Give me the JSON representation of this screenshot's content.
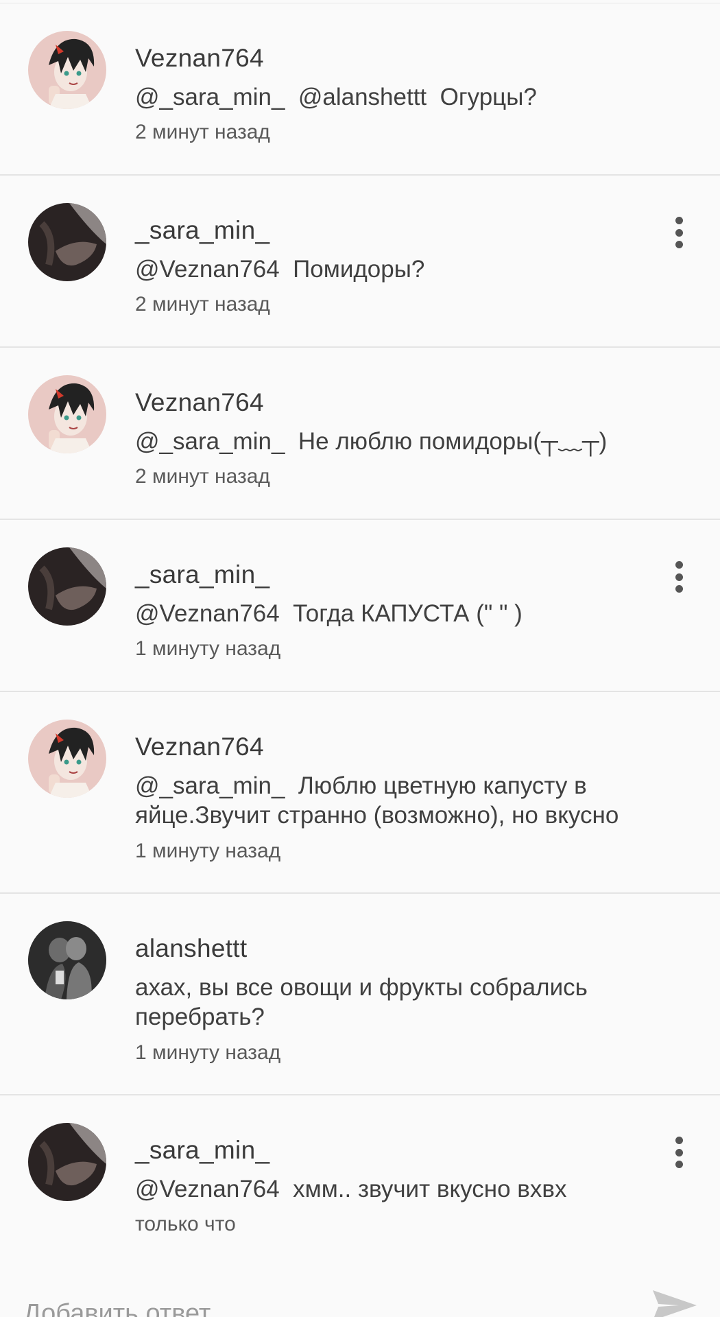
{
  "comments": [
    {
      "username": "Veznan764",
      "text": "@_sara_min_  @alanshettt  Огурцы?",
      "time": "2 минут назад",
      "avatar": "anime-boy-avatar",
      "has_menu": false
    },
    {
      "username": "_sara_min_",
      "text": "@Veznan764  Помидоры?",
      "time": "2 минут назад",
      "avatar": "dark-photo-avatar",
      "has_menu": true
    },
    {
      "username": "Veznan764",
      "text": "@_sara_min_  Не люблю помидоры(┬﹏┬)",
      "time": "2 минут назад",
      "avatar": "anime-boy-avatar",
      "has_menu": false
    },
    {
      "username": "_sara_min_",
      "text": "@Veznan764  Тогда КАПУСТА (\" \" )",
      "time": "1 минуту назад",
      "avatar": "dark-photo-avatar",
      "has_menu": true
    },
    {
      "username": "Veznan764",
      "text": "@_sara_min_  Люблю цветную капусту в яйце.Звучит странно (возможно), но вкусно",
      "time": "1 минуту назад",
      "avatar": "anime-boy-avatar",
      "has_menu": false
    },
    {
      "username": "alanshettt",
      "text": "ахах, вы все овощи и фрукты собрались перебрать?",
      "time": "1 минуту назад",
      "avatar": "couple-photo-avatar",
      "has_menu": false
    },
    {
      "username": "_sara_min_",
      "text": "@Veznan764  хмм.. звучит вкусно вхвх",
      "time": "только что",
      "avatar": "dark-photo-avatar",
      "has_menu": true
    }
  ],
  "reply": {
    "placeholder": "Добавить ответ",
    "send_icon": "send-arrow-icon"
  },
  "colors": {
    "background": "#fafafa",
    "divider": "#e4e4e4",
    "text": "#404040",
    "placeholder": "#9a9a9a"
  }
}
